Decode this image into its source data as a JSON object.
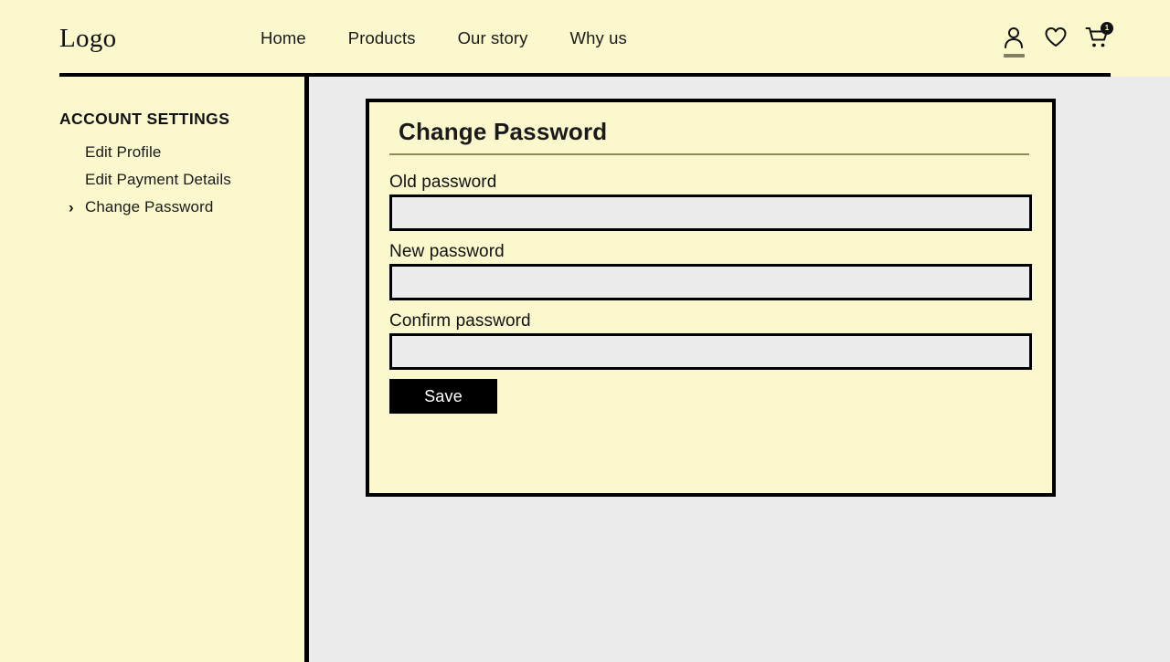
{
  "theme": {
    "cream": "#fbf8cd",
    "page_background": "#ececec",
    "ink": "#000000",
    "rule_olive": "#8c8c57",
    "accent_underline": "#7f7f66"
  },
  "header": {
    "logo": "Logo",
    "nav": [
      {
        "label": "Home"
      },
      {
        "label": "Products"
      },
      {
        "label": "Our story"
      },
      {
        "label": "Why us"
      }
    ],
    "actions": {
      "account_icon": "person-icon",
      "wishlist_icon": "heart-icon",
      "cart_icon": "shopping-cart-icon",
      "cart_count": "1"
    }
  },
  "sidebar": {
    "title": "ACCOUNT SETTINGS",
    "items": [
      {
        "label": "Edit Profile",
        "active": false
      },
      {
        "label": "Edit Payment Details",
        "active": false
      },
      {
        "label": "Change Password",
        "active": true
      }
    ],
    "active_marker": "›"
  },
  "card": {
    "title": "Change Password",
    "fields": [
      {
        "label": "Old password",
        "value": "",
        "placeholder": ""
      },
      {
        "label": "New password",
        "value": "",
        "placeholder": ""
      },
      {
        "label": "Confirm password",
        "value": "",
        "placeholder": ""
      }
    ],
    "save_label": "Save"
  }
}
